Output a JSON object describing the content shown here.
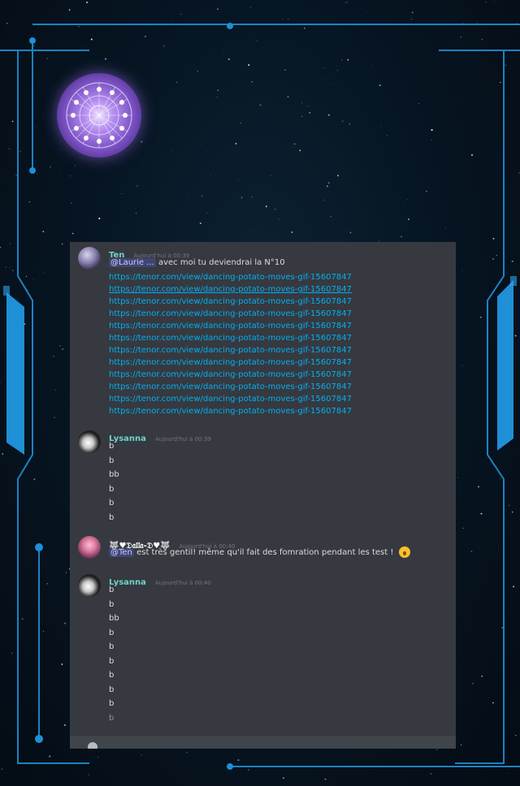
{
  "background": {
    "frame_color": "#1f8fd6",
    "chat_bg": "#36393f"
  },
  "icons": {
    "zodiac": "zodiac-wheel-icon"
  },
  "messages": [
    {
      "author": "Ten",
      "timestamp": "Aujourd'hui à 00:39",
      "mention": "@Laurie ...",
      "text": "avec moi tu deviendrai la N°10",
      "links": [
        "https://tenor.com/view/dancing-potato-moves-gif-15607847",
        "https://tenor.com/view/dancing-potato-moves-gif-15607847",
        "https://tenor.com/view/dancing-potato-moves-gif-15607847",
        "https://tenor.com/view/dancing-potato-moves-gif-15607847",
        "https://tenor.com/view/dancing-potato-moves-gif-15607847",
        "https://tenor.com/view/dancing-potato-moves-gif-15607847",
        "https://tenor.com/view/dancing-potato-moves-gif-15607847",
        "https://tenor.com/view/dancing-potato-moves-gif-15607847",
        "https://tenor.com/view/dancing-potato-moves-gif-15607847",
        "https://tenor.com/view/dancing-potato-moves-gif-15607847",
        "https://tenor.com/view/dancing-potato-moves-gif-15607847",
        "https://tenor.com/view/dancing-potato-moves-gif-15607847"
      ]
    },
    {
      "author": "Lysanna",
      "timestamp": "Aujourd'hui à 00:39",
      "lines": [
        "b",
        "b",
        "bb",
        "b",
        "b",
        "b"
      ]
    },
    {
      "author": "🐺♥𝔇𝔞𝔩𝔩𝔞-𝔇♥🐺",
      "timestamp": "Aujourd'hui à 00:40",
      "mention": "@Ten",
      "text": "est très gentil! même qu'il fait des fomration pendant les test !",
      "emoji": "hushed-face-emoji"
    },
    {
      "author": "Lysanna",
      "timestamp": "Aujourd'hui à 00:40",
      "lines": [
        "b",
        "b",
        "bb",
        "b",
        "b",
        "b",
        "b",
        "b",
        "b",
        "b"
      ]
    }
  ]
}
